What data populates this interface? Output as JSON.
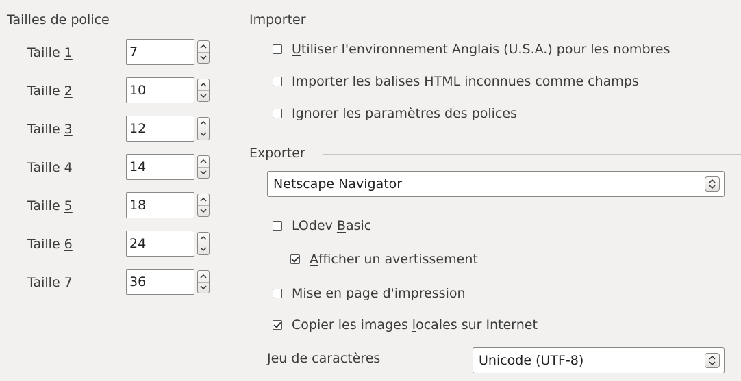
{
  "font_sizes": {
    "title": "Tailles de police",
    "rows": [
      {
        "prefix": "Taille ",
        "mnemonic": "1",
        "value": "7"
      },
      {
        "prefix": "Taille ",
        "mnemonic": "2",
        "value": "10"
      },
      {
        "prefix": "Taille ",
        "mnemonic": "3",
        "value": "12"
      },
      {
        "prefix": "Taille ",
        "mnemonic": "4",
        "value": "14"
      },
      {
        "prefix": "Taille ",
        "mnemonic": "5",
        "value": "18"
      },
      {
        "prefix": "Taille ",
        "mnemonic": "6",
        "value": "24"
      },
      {
        "prefix": "Taille ",
        "mnemonic": "7",
        "value": "36"
      }
    ]
  },
  "import": {
    "title": "Importer",
    "options": [
      {
        "before": "",
        "mnemonic": "U",
        "after": "tiliser l'environnement Anglais (U.S.A.) pour les nombres",
        "checked": false
      },
      {
        "before": "Importer les ",
        "mnemonic": "b",
        "after": "alises HTML inconnues comme champs",
        "checked": false
      },
      {
        "before": "",
        "mnemonic": "I",
        "after": "gnorer les paramètres des polices",
        "checked": false
      }
    ]
  },
  "export": {
    "title": "Exporter",
    "browser_select": "Netscape Navigator",
    "options": {
      "lodev_basic": {
        "before": "LOdev ",
        "mnemonic": "B",
        "after": "asic",
        "checked": false
      },
      "show_warning": {
        "before": "",
        "mnemonic": "A",
        "after": "fficher un avertissement",
        "checked": true
      },
      "print_layout": {
        "before": "",
        "mnemonic": "M",
        "after": "ise en page d'impression",
        "checked": false
      },
      "copy_images": {
        "before": "Copier les images ",
        "mnemonic": "l",
        "after": "ocales sur Internet",
        "checked": true
      }
    },
    "charset": {
      "label_mnemonic": "J",
      "label_rest": "eu de caractères",
      "value": "Unicode (UTF-8)"
    }
  },
  "colors": {
    "background": "#f2f1f0",
    "text": "#3c3c3c",
    "border": "#8a8885"
  }
}
